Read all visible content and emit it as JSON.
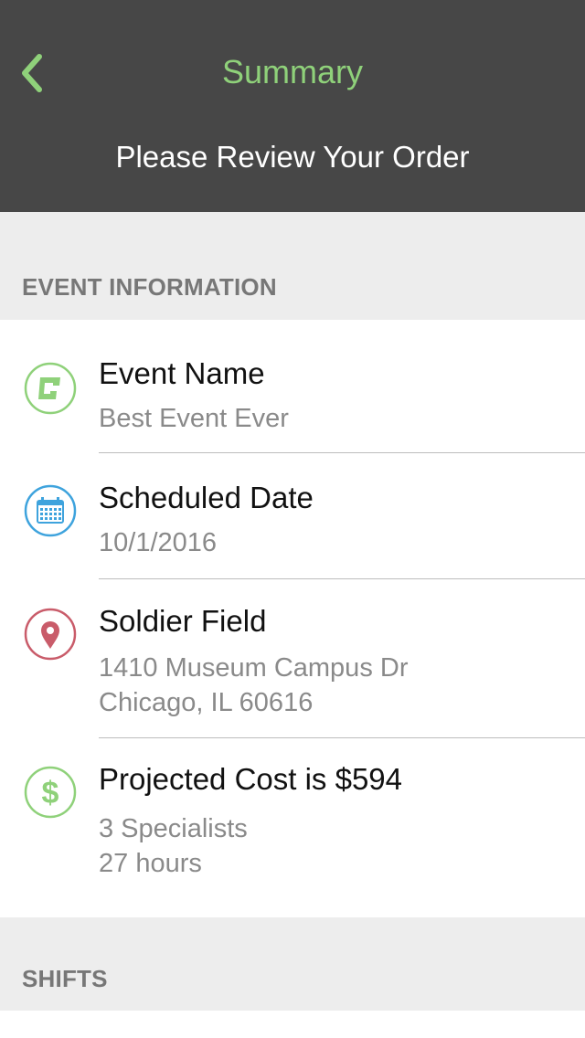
{
  "nav": {
    "title": "Summary",
    "subtitle": "Please Review Your Order",
    "back_icon": "chevron-left-icon"
  },
  "colors": {
    "header_bg": "#474747",
    "accent_green": "#8fd17a",
    "icon_blue": "#3ea3dd",
    "icon_red": "#c95c6a"
  },
  "sections": {
    "event_info": "EVENT INFORMATION",
    "shifts": "SHIFTS"
  },
  "event": {
    "name_label": "Event Name",
    "name_value": "Best Event Ever",
    "date_label": "Scheduled Date",
    "date_value": "10/1/2016",
    "venue_name": "Soldier Field",
    "address_line1": "1410 Museum Campus Dr",
    "address_line2": "Chicago, IL  60616",
    "cost_label": "Projected Cost is $594",
    "specialists": "3 Specialists",
    "hours": "27 hours"
  },
  "icons": {
    "event": "event-logo-icon",
    "date": "calendar-icon",
    "location": "map-pin-icon",
    "cost": "dollar-icon"
  }
}
